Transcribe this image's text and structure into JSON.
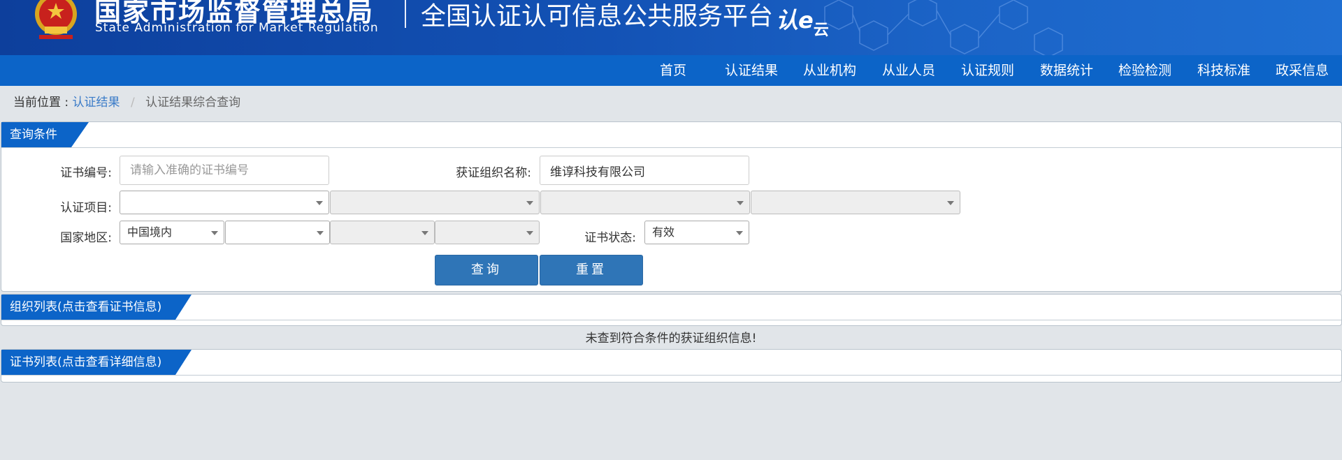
{
  "header": {
    "org_name_cn": "国家市场监督管理总局",
    "org_name_en": "State Administration  for  Market Regulation",
    "platform_title": "全国认证认可信息公共服务平台",
    "logo_text": "认e",
    "logo_sub": "云"
  },
  "nav": {
    "items": [
      "首页",
      "认证结果",
      "从业机构",
      "从业人员",
      "认证规则",
      "数据统计",
      "检验检测",
      "科技标准",
      "政采信息"
    ]
  },
  "breadcrumb": {
    "label": "当前位置 :",
    "link": "认证结果",
    "separator": "/",
    "current": "认证结果综合查询"
  },
  "query_panel": {
    "title": "查询条件",
    "cert_no_label": "证书编号:",
    "cert_no_placeholder": "请输入准确的证书编号",
    "org_name_label": "获证组织名称:",
    "org_name_value": "维谆科技有限公司",
    "project_label": "认证项目:",
    "region_label": "国家地区:",
    "region_value": "中国境内",
    "status_label": "证书状态:",
    "status_value": "有效",
    "search_label": "查询",
    "reset_label": "重置"
  },
  "org_list": {
    "title": "组织列表(点击查看证书信息)",
    "empty_message": "未查到符合条件的获证组织信息!"
  },
  "cert_list": {
    "title": "证书列表(点击查看详细信息)"
  },
  "colors": {
    "header_bg": "#1352b5",
    "nav_bg": "#0c64c8",
    "panel_title_bg": "#0c64c8",
    "button_bg": "#2f75b7",
    "page_bg": "#e1e5e9"
  }
}
